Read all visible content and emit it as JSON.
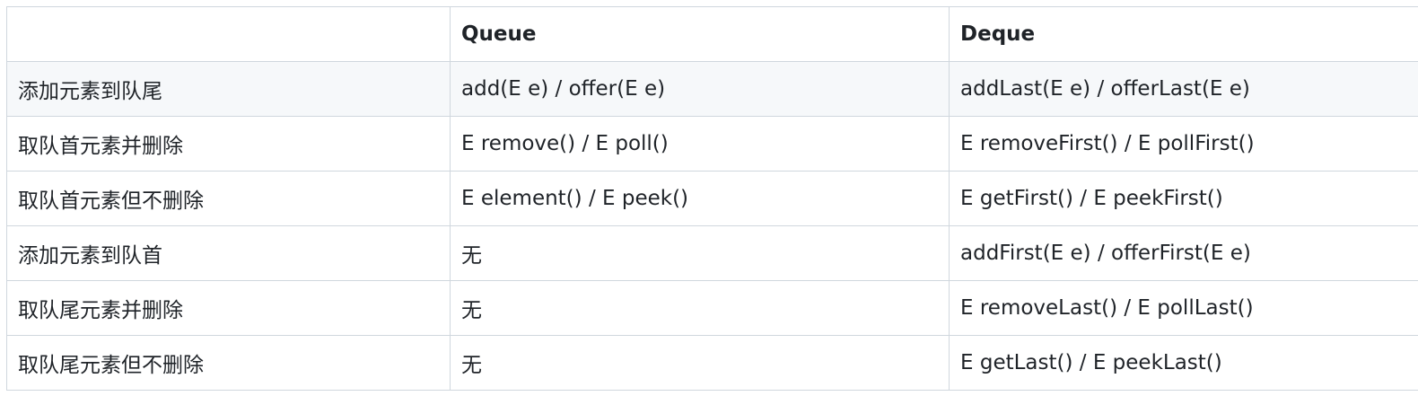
{
  "table": {
    "headers": [
      "",
      "Queue",
      "Deque"
    ],
    "rows": [
      [
        "添加元素到队尾",
        "add(E e) / offer(E e)",
        "addLast(E e) / offerLast(E e)"
      ],
      [
        "取队首元素并删除",
        "E remove() / E poll()",
        "E removeFirst() / E pollFirst()"
      ],
      [
        "取队首元素但不删除",
        "E element() / E peek()",
        "E getFirst() / E peekFirst()"
      ],
      [
        "添加元素到队首",
        "无",
        "addFirst(E e) / offerFirst(E e)"
      ],
      [
        "取队尾元素并删除",
        "无",
        "E removeLast() / E pollLast()"
      ],
      [
        "取队尾元素但不删除",
        "无",
        "E getLast() / E peekLast()"
      ]
    ]
  }
}
